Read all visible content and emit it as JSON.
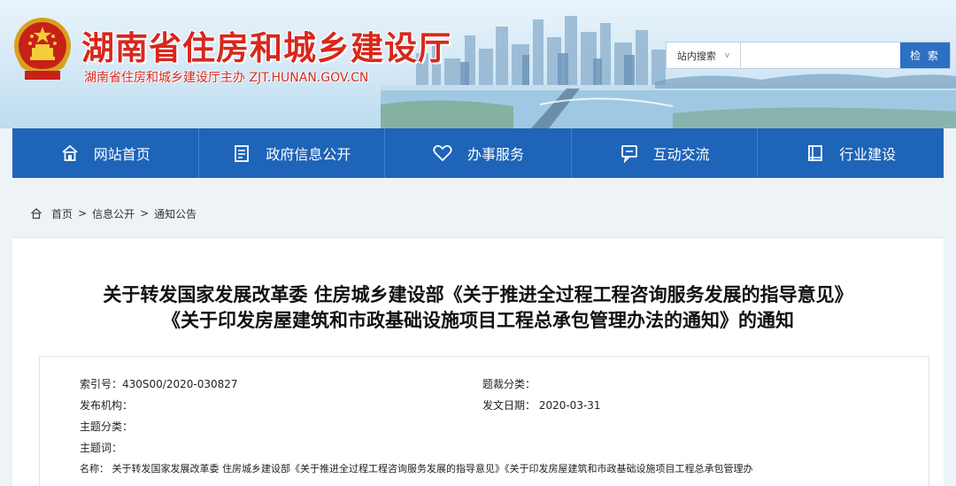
{
  "header": {
    "title": "湖南省住房和城乡建设厅",
    "subtitle": "湖南省住房和城乡建设厅主办  ZJT.HUNAN.GOV.CN",
    "search": {
      "scope": "站内搜索",
      "placeholder": "",
      "button_label": "检 索"
    }
  },
  "nav": {
    "items": [
      {
        "label": "网站首页",
        "icon": "home-icon"
      },
      {
        "label": "政府信息公开",
        "icon": "document-icon"
      },
      {
        "label": "办事服务",
        "icon": "heart-icon"
      },
      {
        "label": "互动交流",
        "icon": "chat-icon"
      },
      {
        "label": "行业建设",
        "icon": "book-icon"
      }
    ]
  },
  "breadcrumb": {
    "items": [
      "首页",
      "信息公开",
      "通知公告"
    ],
    "separator": ">"
  },
  "article": {
    "title_line1": "关于转发国家发展改革委 住房城乡建设部《关于推进全过程工程咨询服务发展的指导意见》",
    "title_line2": "《关于印发房屋建筑和市政基础设施项目工程总承包管理办法的通知》的通知",
    "meta": {
      "index_no": "索引号：430S00/2020-030827",
      "publisher": "发布机构：",
      "subject_category": "主题分类：",
      "keywords": "主题词：",
      "name": "名称：  关于转发国家发展改革委 住房城乡建设部《关于推进全过程工程咨询服务发展的指导意见》《关于印发房屋建筑和市政基础设施项目工程总承包管理办",
      "genre_category": "题裁分类：",
      "issue_date": "发文日期： 2020-03-31"
    }
  },
  "colors": {
    "nav_blue": "#1e64b8",
    "title_red": "#d8271c",
    "search_button": "#2d6fc0"
  }
}
